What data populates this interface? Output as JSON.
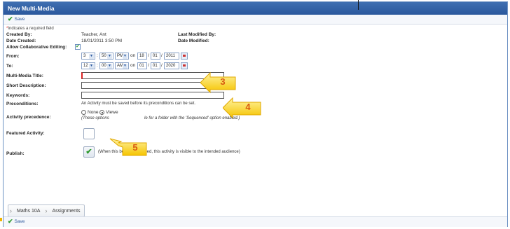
{
  "window": {
    "title": "New Multi-Media"
  },
  "toolbar": {
    "save_label": "Save"
  },
  "required_note": "Indicates a required field",
  "meta": {
    "created_by_label": "Created By:",
    "created_by_value": "Teacher, Ant",
    "last_modified_by_label": "Last Modified By:",
    "date_created_label": "Date Created:",
    "date_created_value": "18/01/2011 3:50 PM",
    "date_modified_label": "Date Modified:"
  },
  "form": {
    "collab_label": "Allow Collaborative Editing:",
    "from_label": "From:",
    "to_label": "To:",
    "from": {
      "hour": "3",
      "minute": "50",
      "ampm": "PM",
      "on": "on",
      "day": "18",
      "month": "01",
      "year": "2011"
    },
    "to": {
      "hour": "12",
      "minute": "00",
      "ampm": "AM",
      "on": "on",
      "day": "01",
      "month": "01",
      "year": "2020"
    },
    "title_label": "Multi-Media Title:",
    "short_desc_label": "Short Description:",
    "keywords_label": "Keywords:",
    "preconditions_label": "Preconditions:",
    "preconditions_text": "An Activity must be saved before its preconditions can be set.",
    "precedence_label": "Activity precedence:",
    "precedence_none": "None",
    "precedence_viewed": "Viewe",
    "precedence_note_a": "(These options",
    "precedence_note_b": "le for a folder with the 'Sequenced' option enabled.)",
    "featured_label": "Featured Activity:",
    "publish_label": "Publish:",
    "publish_note_a": "(When this bo",
    "publish_note_b": "s ticked, this activity is visible to the intended audience)"
  },
  "callouts": {
    "c3": "3",
    "c4": "4",
    "c5": "5"
  },
  "breadcrumb": {
    "item1": "Maths 10A",
    "item2": "Assignments"
  },
  "footer": {
    "save_label": "Save"
  },
  "colors": {
    "title_bar": "#2a579c",
    "check": "#2f9a2f",
    "callout": "#f5c400",
    "callout_text": "#d85a10"
  }
}
